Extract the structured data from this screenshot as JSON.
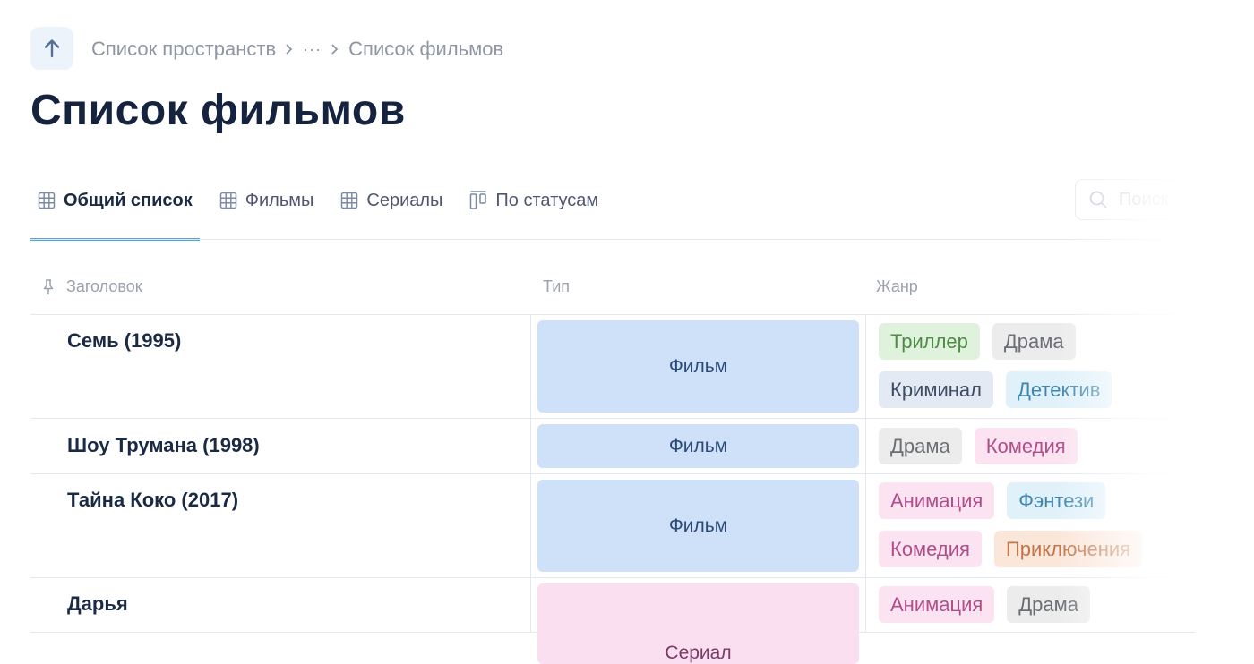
{
  "breadcrumb": {
    "items": [
      "Список пространств",
      "···",
      "Список фильмов"
    ]
  },
  "page": {
    "title": "Список фильмов"
  },
  "tabs": [
    {
      "label": "Общий список",
      "icon": "table-icon",
      "active": true
    },
    {
      "label": "Фильмы",
      "icon": "table-icon",
      "active": false
    },
    {
      "label": "Сериалы",
      "icon": "table-icon",
      "active": false
    },
    {
      "label": "По статусам",
      "icon": "kanban-icon",
      "active": false
    }
  ],
  "search": {
    "placeholder": "Поиск"
  },
  "table": {
    "columns": [
      "Заголовок",
      "Тип",
      "Жанр"
    ],
    "rows": [
      {
        "title": "Семь (1995)",
        "type": "Фильм",
        "genres": [
          {
            "label": "Триллер",
            "bg": "#dff3dc",
            "fg": "#4f8a47"
          },
          {
            "label": "Драма",
            "bg": "#ececec",
            "fg": "#6b6f75"
          },
          {
            "label": "Криминал",
            "bg": "#e4eaf4",
            "fg": "#3e4c63"
          },
          {
            "label": "Детектив",
            "bg": "#e1f1fa",
            "fg": "#3f85ad"
          }
        ]
      },
      {
        "title": "Шоу Трумана (1998)",
        "type": "Фильм",
        "genres": [
          {
            "label": "Драма",
            "bg": "#ececec",
            "fg": "#6b6f75"
          },
          {
            "label": "Комедия",
            "bg": "#fbe3f1",
            "fg": "#b04e8a"
          }
        ]
      },
      {
        "title": "Тайна Коко (2017)",
        "type": "Фильм",
        "genres": [
          {
            "label": "Анимация",
            "bg": "#fbe3f1",
            "fg": "#b04e8a"
          },
          {
            "label": "Фэнтези",
            "bg": "#e1f1fa",
            "fg": "#3f85ad"
          },
          {
            "label": "Комедия",
            "bg": "#fbe3f1",
            "fg": "#b04e8a"
          },
          {
            "label": "Приключения",
            "bg": "#fbe6da",
            "fg": "#c07648"
          }
        ]
      },
      {
        "title": "Дарья",
        "type": "Сериал",
        "genres": [
          {
            "label": "Анимация",
            "bg": "#fbe3f1",
            "fg": "#b04e8a"
          },
          {
            "label": "Драма",
            "bg": "#ececec",
            "fg": "#6b6f75"
          }
        ]
      }
    ]
  },
  "colors": {
    "accent": "#54a4d6",
    "title": "#15233f",
    "film_bg": "#cfe0f9",
    "serial_bg": "#fadff0"
  }
}
